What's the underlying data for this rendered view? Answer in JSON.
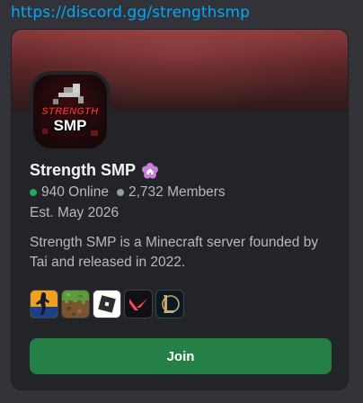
{
  "invite": {
    "url_text": "https://discord.gg/strengthsmp"
  },
  "server": {
    "name": "Strength SMP",
    "icon_text_top": "STRENGTH",
    "icon_text_bottom": "SMP",
    "badge_icon": "home-flower-badge-icon",
    "online_count": "940 Online",
    "member_count": "2,732 Members",
    "established": "Est. May 2026",
    "description": "Strength SMP is a Minecraft server founded by Tai and released in 2022."
  },
  "games": [
    {
      "name": "counter-strike-icon"
    },
    {
      "name": "minecraft-icon"
    },
    {
      "name": "roblox-icon"
    },
    {
      "name": "valorant-icon"
    },
    {
      "name": "league-of-legends-icon"
    }
  ],
  "actions": {
    "join_label": "Join"
  },
  "colors": {
    "link": "#00a8fc",
    "online": "#23a55a",
    "join_button": "#248046",
    "badge": "#c87fd9"
  }
}
